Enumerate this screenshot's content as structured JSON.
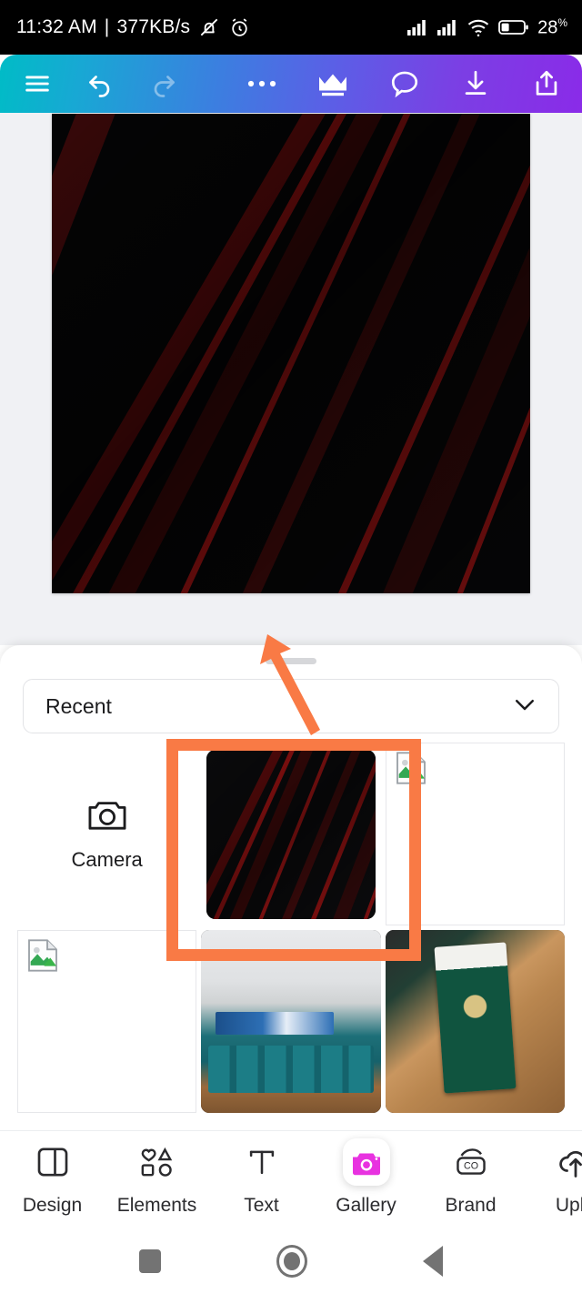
{
  "status_bar": {
    "time": "11:32 AM",
    "separator": "|",
    "network_speed": "377KB/s",
    "mute_icon": "bell-muted-icon",
    "alarm_icon": "alarm-clock-icon",
    "signal_1_icon": "signal-bars-icon",
    "signal_2_icon": "signal-bars-icon",
    "wifi_icon": "wifi-icon",
    "battery_icon": "battery-icon",
    "battery_level": "28",
    "battery_unit": "%"
  },
  "toolbar": {
    "gradient_start": "#00bcc6",
    "gradient_end": "#8a2be8",
    "menu_icon": "hamburger-menu-icon",
    "undo_icon": "undo-icon",
    "redo_icon": "redo-icon",
    "more_icon": "three-dots-icon",
    "crown_icon": "crown-icon",
    "comment_icon": "comment-bubble-icon",
    "download_icon": "download-icon",
    "share_icon": "share-upload-icon"
  },
  "canvas": {
    "background_color": "#050505",
    "accent_color": "#b01515",
    "description": "black background with red diagonal streaks"
  },
  "sheet": {
    "dropdown": {
      "value": "Recent",
      "chevron_icon": "chevron-down-icon"
    },
    "gallery": {
      "camera": {
        "label": "Camera",
        "icon": "camera-icon"
      },
      "items": [
        {
          "name": "selected-red-abstract-thumbnail",
          "kind": "image",
          "selected": true
        },
        {
          "name": "broken-image-thumbnail",
          "kind": "broken",
          "selected": false
        },
        {
          "name": "broken-image-thumbnail",
          "kind": "broken",
          "selected": false
        },
        {
          "name": "auditorium-photo-thumbnail",
          "kind": "hall",
          "selected": false
        },
        {
          "name": "passport-photo-thumbnail",
          "kind": "passport",
          "selected": false
        }
      ]
    }
  },
  "annotations": {
    "color": "#f97a45",
    "highlight_box": "selection-highlight-box",
    "arrow": "pointer-arrow"
  },
  "bottom_nav": {
    "active": "Gallery",
    "active_color": "#e832e0",
    "items": [
      {
        "label": "Design",
        "icon": "layout-design-icon"
      },
      {
        "label": "Elements",
        "icon": "shapes-elements-icon"
      },
      {
        "label": "Text",
        "icon": "text-t-icon"
      },
      {
        "label": "Gallery",
        "icon": "camera-gallery-icon"
      },
      {
        "label": "Brand",
        "icon": "brand-co-icon"
      },
      {
        "label": "Uplo",
        "icon": "cloud-upload-icon"
      }
    ]
  },
  "android_nav": {
    "recents_icon": "square-recents-icon",
    "home_icon": "circle-home-icon",
    "back_icon": "triangle-back-icon"
  }
}
